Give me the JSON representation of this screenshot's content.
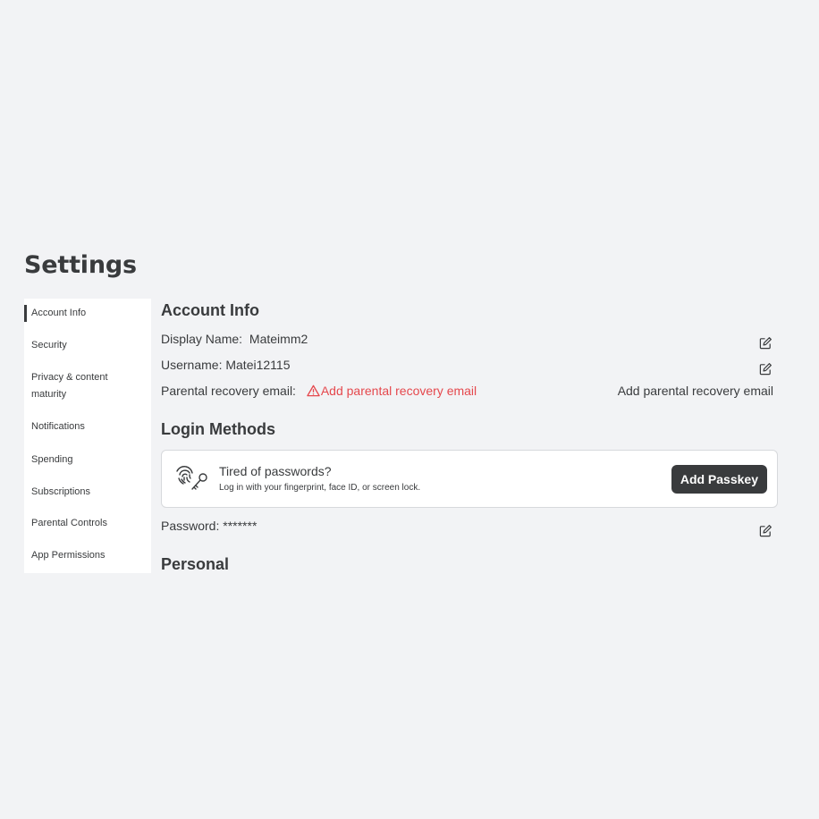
{
  "page": {
    "title": "Settings"
  },
  "sidebar": {
    "items": [
      {
        "label": "Account Info"
      },
      {
        "label": "Security"
      },
      {
        "label": "Privacy & content maturity"
      },
      {
        "label": "Notifications"
      },
      {
        "label": "Spending"
      },
      {
        "label": "Subscriptions"
      },
      {
        "label": "Parental Controls"
      },
      {
        "label": "App Permissions"
      }
    ]
  },
  "account_info": {
    "title": "Account Info",
    "display_name_label": "Display Name:",
    "display_name_value": "Mateimm2",
    "username_label": "Username:",
    "username_value": "Matei12115",
    "parental_label": "Parental recovery email:",
    "parental_warning_link": "Add parental recovery email",
    "parental_action": "Add parental recovery email"
  },
  "login_methods": {
    "title": "Login Methods",
    "passkey_title": "Tired of passwords?",
    "passkey_subtitle": "Log in with your fingerprint, face ID, or screen lock.",
    "passkey_button": "Add Passkey",
    "password_label": "Password:",
    "password_value": "*******"
  },
  "personal": {
    "title": "Personal"
  },
  "colors": {
    "background": "#f2f3f5",
    "text": "#393b3d",
    "warning": "#e5484d",
    "button_bg": "#393b3d"
  }
}
